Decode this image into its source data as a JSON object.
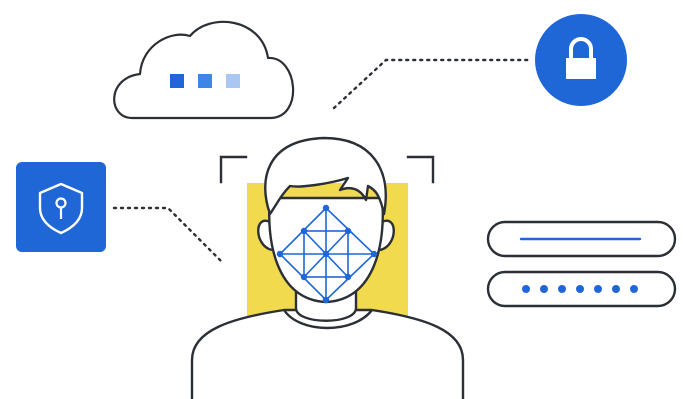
{
  "illustration": {
    "colors": {
      "outline": "#2b2f36",
      "accent_blue": "#1f66d6",
      "accent_blue_mid": "#3d86e6",
      "accent_blue_light": "#a9c7f2",
      "highlight_yellow": "#f2da4e",
      "background": "#ffffff"
    },
    "elements": {
      "cloud": {
        "icon": "cloud-icon",
        "status_dots": 3
      },
      "lock": {
        "icon": "lock-icon"
      },
      "shield": {
        "icon": "shield-keyhole-icon"
      },
      "face": {
        "icon": "face-scan-icon",
        "mesh_nodes": 9
      },
      "credentials": {
        "username_field": "username-field-icon",
        "password_field": "password-field-icon",
        "masked_chars": 7
      }
    }
  }
}
